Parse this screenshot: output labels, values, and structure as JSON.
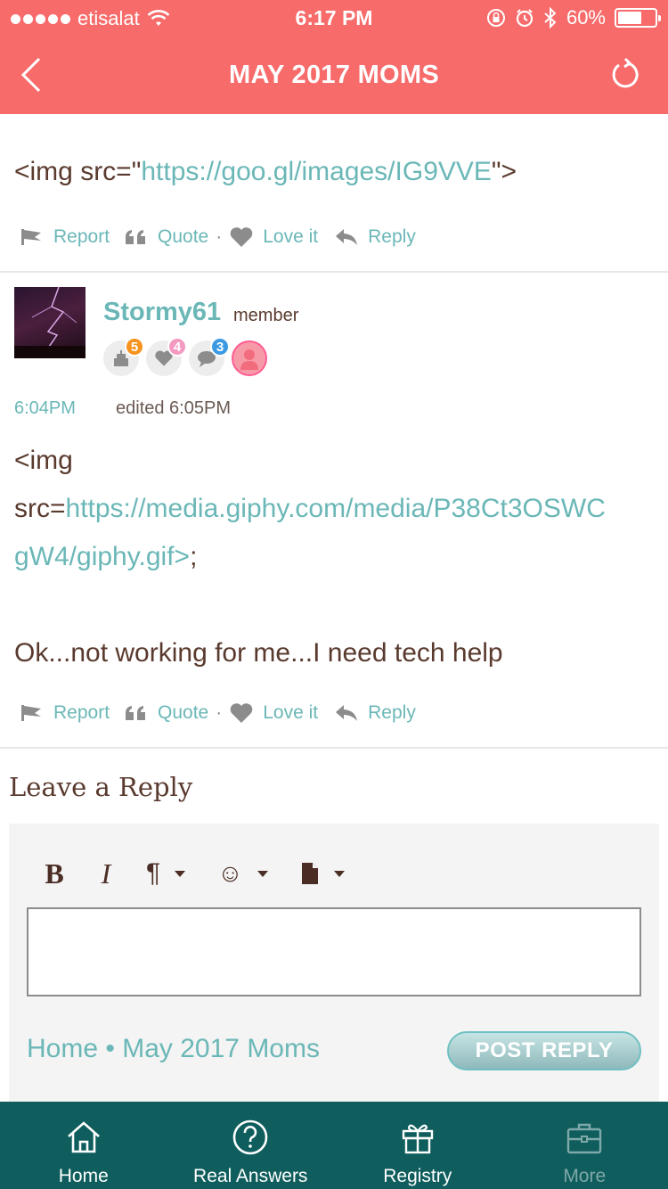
{
  "status_bar": {
    "carrier": "etisalat",
    "time": "6:17 PM",
    "battery": "60%",
    "battery_level": 0.6
  },
  "nav": {
    "title": "MAY 2017 MOMS"
  },
  "post1": {
    "text_prefix": "<img src=\"",
    "link": "https://goo.gl/images/IG9VVE",
    "text_suffix": "\">"
  },
  "actions": {
    "report": "Report",
    "quote": "Quote",
    "separator": "·",
    "love": "Love it",
    "reply": "Reply"
  },
  "post2": {
    "username": "Stormy61",
    "role": "member",
    "badges": [
      {
        "icon": "cake-icon",
        "count": "5",
        "color": "#f7931e"
      },
      {
        "icon": "heart-icon",
        "count": "4",
        "color": "#f49ac1"
      },
      {
        "icon": "comment-icon",
        "count": "3",
        "color": "#3b9ae1"
      }
    ],
    "time": "6:04PM",
    "edited": "edited 6:05PM",
    "line1": "<img",
    "line2_prefix": "src=",
    "line2_link": "https://media.giphy.com/media/P38Ct3OSWC",
    "line3_link": "gW4/giphy.gif>",
    "line3_suffix": ";",
    "message": "Ok...not working for me...I need tech help"
  },
  "reply": {
    "heading": "Leave a Reply",
    "toolbar": {
      "bold": "B",
      "italic": "I",
      "paragraph": "¶",
      "emoji": "☺"
    },
    "breadcrumb_home": "Home",
    "breadcrumb_sep": "•",
    "breadcrumb_group": "May 2017 Moms",
    "post_button": "POST REPLY"
  },
  "tabs": [
    {
      "label": "Home",
      "icon": "home-icon"
    },
    {
      "label": "Real Answers",
      "icon": "question-icon"
    },
    {
      "label": "Registry",
      "icon": "gift-icon"
    },
    {
      "label": "More",
      "icon": "briefcase-icon"
    }
  ]
}
